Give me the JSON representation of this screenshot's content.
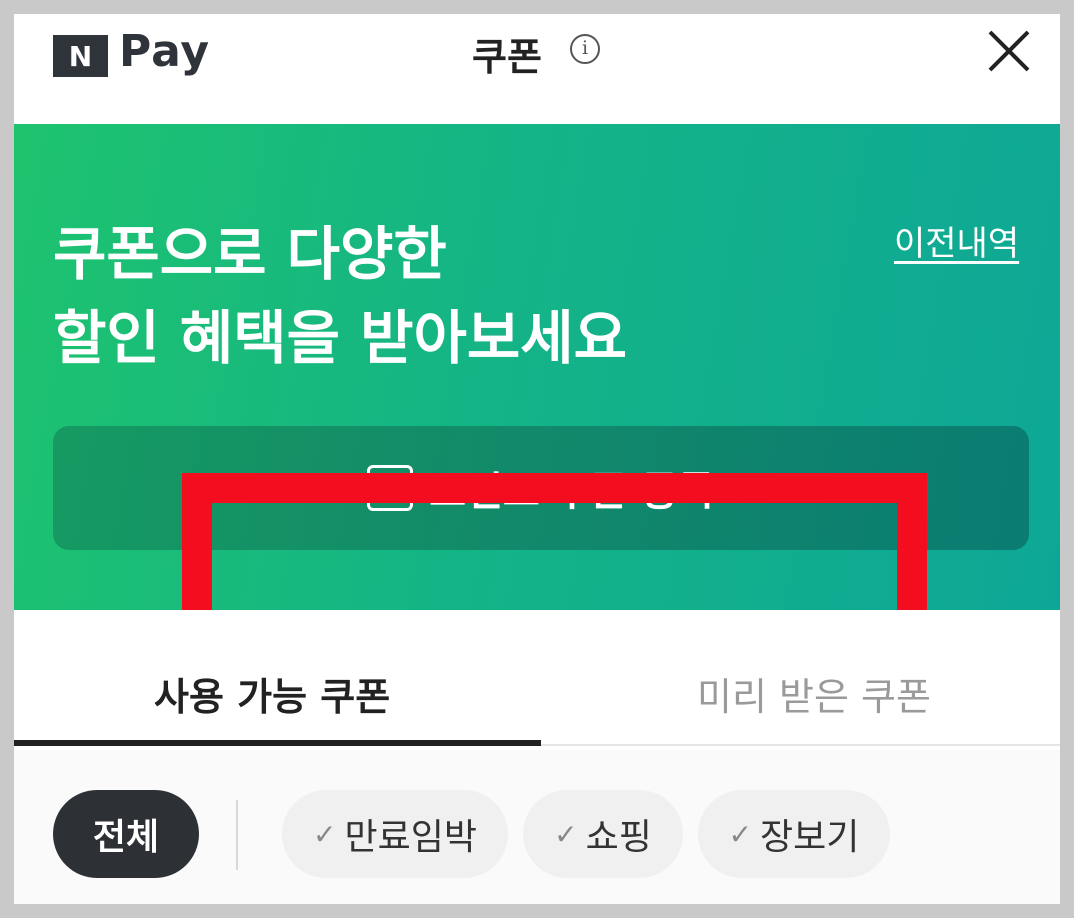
{
  "header": {
    "logo_letter": "N",
    "logo_text": "Pay",
    "title": "쿠폰",
    "info_icon": "info-icon",
    "close_icon": "close-icon"
  },
  "banner": {
    "headline_line1": "쿠폰으로 다양한",
    "headline_line2": "할인 혜택을 받아보세요",
    "history_link": "이전내역",
    "register_button": "포인트 쿠폰 등록",
    "register_icon": "n-point-icon"
  },
  "tabs": [
    {
      "label": "사용 가능 쿠폰",
      "active": true
    },
    {
      "label": "미리 받은 쿠폰",
      "active": false
    }
  ],
  "filters": {
    "all_label": "전체",
    "chips": [
      {
        "label": "만료임박",
        "icon": "check-icon"
      },
      {
        "label": "쇼핑",
        "icon": "check-icon"
      },
      {
        "label": "장보기",
        "icon": "check-icon"
      }
    ]
  },
  "colors": {
    "brand_dark": "#2f333a",
    "banner_green": "#1ec36e",
    "banner_teal": "#0ea797",
    "highlight_red": "#f40d1e"
  }
}
